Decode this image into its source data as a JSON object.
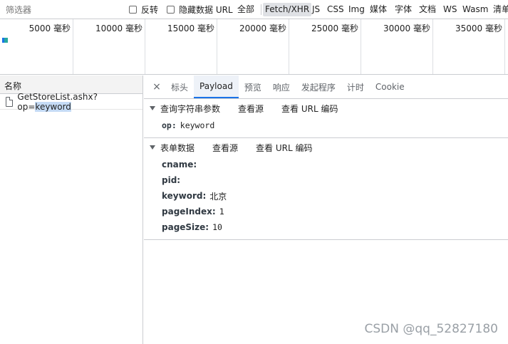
{
  "filter_bar": {
    "filter_placeholder": "筛选器",
    "invert_label": "反转",
    "hide_data_urls_label": "隐藏数据 URL",
    "type_filters": [
      "全部",
      "Fetch/XHR",
      "JS",
      "CSS",
      "Img",
      "媒体",
      "字体",
      "文档",
      "WS",
      "Wasm",
      "清单"
    ],
    "selected_type": "Fetch/XHR"
  },
  "overview": {
    "ticks": [
      "5000 毫秒",
      "10000 毫秒",
      "15000 毫秒",
      "20000 毫秒",
      "25000 毫秒",
      "30000 毫秒",
      "35000 毫秒"
    ]
  },
  "request_list": {
    "header": "名称",
    "requests": [
      {
        "name_prefix": "GetStoreList.ashx?op=",
        "name_highlight": "keyword"
      }
    ]
  },
  "detail": {
    "tabs": [
      "标头",
      "Payload",
      "预览",
      "响应",
      "发起程序",
      "计时",
      "Cookie"
    ],
    "active_tab": "Payload",
    "close_glyph": "×",
    "query_section": {
      "title": "查询字符串参数",
      "view_source": "查看源",
      "view_url_encoded": "查看 URL 编码",
      "params": [
        {
          "key": "op:",
          "value": "keyword"
        }
      ]
    },
    "form_section": {
      "title": "表单数据",
      "view_source": "查看源",
      "view_url_encoded": "查看 URL 编码",
      "params": [
        {
          "key": "cname:",
          "value": ""
        },
        {
          "key": "pid:",
          "value": ""
        },
        {
          "key": "keyword:",
          "value": "北京"
        },
        {
          "key": "pageIndex:",
          "value": "1"
        },
        {
          "key": "pageSize:",
          "value": "10"
        }
      ]
    }
  },
  "watermark": "CSDN @qq_52827180"
}
